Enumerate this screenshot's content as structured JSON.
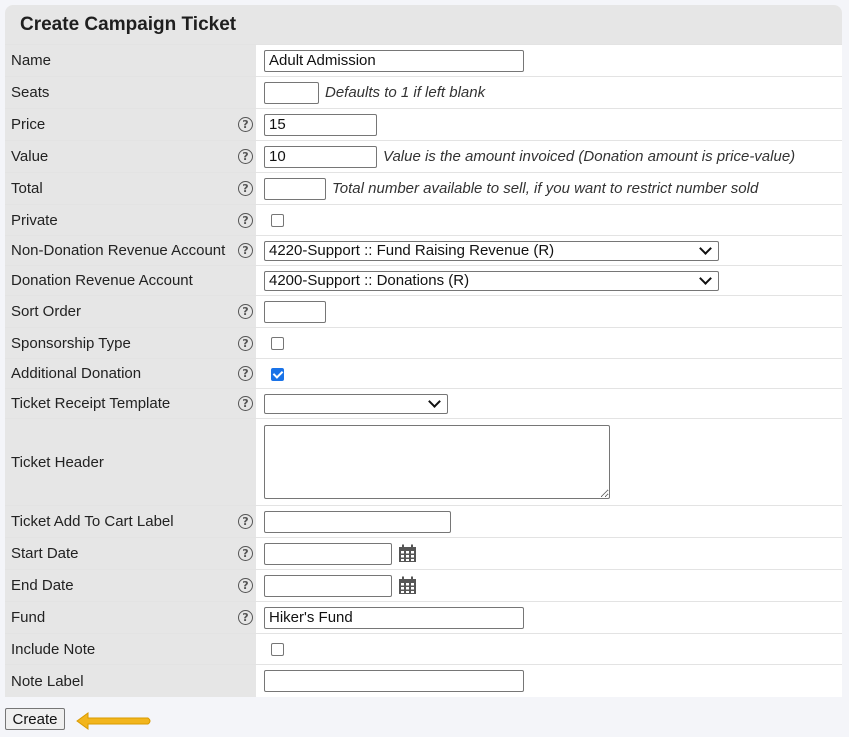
{
  "form": {
    "title": "Create Campaign Ticket",
    "submit_label": "Create",
    "fields": {
      "name": {
        "label": "Name",
        "value": "Adult Admission"
      },
      "seats": {
        "label": "Seats",
        "value": "",
        "hint": "Defaults to 1 if left blank"
      },
      "price": {
        "label": "Price",
        "value": "15"
      },
      "value": {
        "label": "Value",
        "value": "10",
        "hint": "Value is the amount invoiced (Donation amount is price-value)"
      },
      "total": {
        "label": "Total",
        "value": "",
        "hint": "Total number available to sell, if you want to restrict number sold"
      },
      "private": {
        "label": "Private",
        "checked": false
      },
      "non_donation_account": {
        "label": "Non-Donation Revenue Account",
        "selected": "4220-Support :: Fund Raising Revenue (R)"
      },
      "donation_account": {
        "label": "Donation Revenue Account",
        "selected": "4200-Support :: Donations (R)"
      },
      "sort_order": {
        "label": "Sort Order",
        "value": ""
      },
      "sponsorship_type": {
        "label": "Sponsorship Type",
        "checked": false
      },
      "additional_donation": {
        "label": "Additional Donation",
        "checked": true
      },
      "receipt_template": {
        "label": "Ticket Receipt Template",
        "selected": ""
      },
      "ticket_header": {
        "label": "Ticket Header",
        "value": ""
      },
      "add_to_cart_label": {
        "label": "Ticket Add To Cart Label",
        "value": ""
      },
      "start_date": {
        "label": "Start Date",
        "value": ""
      },
      "end_date": {
        "label": "End Date",
        "value": ""
      },
      "fund": {
        "label": "Fund",
        "value": "Hiker's Fund"
      },
      "include_note": {
        "label": "Include Note",
        "checked": false
      },
      "note_label": {
        "label": "Note Label",
        "value": ""
      }
    }
  },
  "colors": {
    "header_bg": "#e6e6e6",
    "checkbox_checked": "#1a73e8",
    "arrow": "#f2b51d"
  },
  "icons": {
    "help": "help-circle-icon",
    "calendar": "calendar-icon",
    "arrow": "arrow-left-icon"
  }
}
